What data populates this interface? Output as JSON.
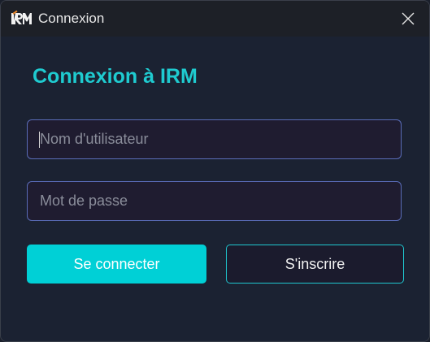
{
  "window": {
    "title": "Connexion",
    "logo_text": "IRM"
  },
  "form": {
    "heading": "Connexion à IRM",
    "username_placeholder": "Nom d'utilisateur",
    "username_value": "",
    "password_placeholder": "Mot de passe",
    "password_value": "",
    "login_label": "Se connecter",
    "register_label": "S'inscrire"
  },
  "icons": {
    "logo": "irm-logo-icon",
    "close": "close-icon"
  },
  "colors": {
    "accent": "#00d0d6",
    "heading": "#1fcbd0",
    "field_border": "#5a6cb8",
    "background": "#1b2232",
    "logo_accent": "#e8862a"
  }
}
